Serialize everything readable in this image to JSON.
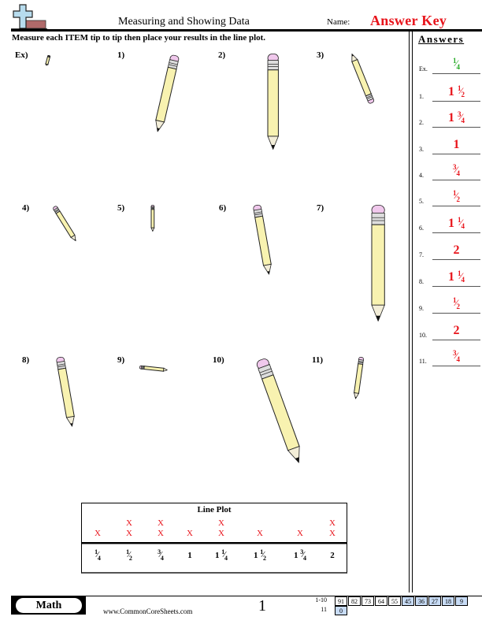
{
  "header": {
    "title": "Measuring and Showing Data",
    "name_label": "Name:",
    "name_value": "Answer Key"
  },
  "instructions": "Measure each ITEM tip to tip then place your results in the line plot.",
  "problems": [
    {
      "label": "Ex)",
      "answer_whole": "",
      "answer_num": "1",
      "answer_den": "4"
    },
    {
      "label": "1)",
      "answer_whole": "1",
      "answer_num": "1",
      "answer_den": "2"
    },
    {
      "label": "2)",
      "answer_whole": "1",
      "answer_num": "3",
      "answer_den": "4"
    },
    {
      "label": "3)",
      "answer_whole": "1",
      "answer_num": "",
      "answer_den": ""
    },
    {
      "label": "4)",
      "answer_whole": "",
      "answer_num": "3",
      "answer_den": "4"
    },
    {
      "label": "5)",
      "answer_whole": "",
      "answer_num": "1",
      "answer_den": "2"
    },
    {
      "label": "6)",
      "answer_whole": "1",
      "answer_num": "1",
      "answer_den": "4"
    },
    {
      "label": "7)",
      "answer_whole": "2",
      "answer_num": "",
      "answer_den": ""
    },
    {
      "label": "8)",
      "answer_whole": "1",
      "answer_num": "1",
      "answer_den": "4"
    },
    {
      "label": "9)",
      "answer_whole": "",
      "answer_num": "1",
      "answer_den": "2"
    },
    {
      "label": "10)",
      "answer_whole": "2",
      "answer_num": "",
      "answer_den": ""
    },
    {
      "label": "11)",
      "answer_whole": "",
      "answer_num": "3",
      "answer_den": "4"
    }
  ],
  "answers": {
    "title": "Answers",
    "numbers": [
      "Ex.",
      "1.",
      "2.",
      "3.",
      "4.",
      "5.",
      "6.",
      "7.",
      "8.",
      "9.",
      "10.",
      "11."
    ],
    "example_color": "#21a821",
    "answer_color": "#e8141b"
  },
  "line_plot": {
    "title": "Line Plot",
    "x_mark": "X",
    "ticks": [
      {
        "whole": "",
        "num": "1",
        "den": "4",
        "count": 1
      },
      {
        "whole": "",
        "num": "1",
        "den": "2",
        "count": 2
      },
      {
        "whole": "",
        "num": "3",
        "den": "4",
        "count": 2
      },
      {
        "whole": "1",
        "num": "",
        "den": "",
        "count": 1
      },
      {
        "whole": "1",
        "num": "1",
        "den": "4",
        "count": 2
      },
      {
        "whole": "1",
        "num": "1",
        "den": "2",
        "count": 1
      },
      {
        "whole": "1",
        "num": "3",
        "den": "4",
        "count": 1
      },
      {
        "whole": "2",
        "num": "",
        "den": "",
        "count": 2
      }
    ]
  },
  "footer": {
    "subject": "Math",
    "site": "www.CommonCoreSheets.com",
    "page": "1",
    "score_rows": [
      {
        "label": "1-10",
        "values": [
          "91",
          "82",
          "73",
          "64",
          "55",
          "45",
          "36",
          "27",
          "18",
          "9"
        ],
        "highlight_from": 5
      },
      {
        "label": "11",
        "values": [
          "0"
        ],
        "highlight_from": 0
      }
    ]
  }
}
